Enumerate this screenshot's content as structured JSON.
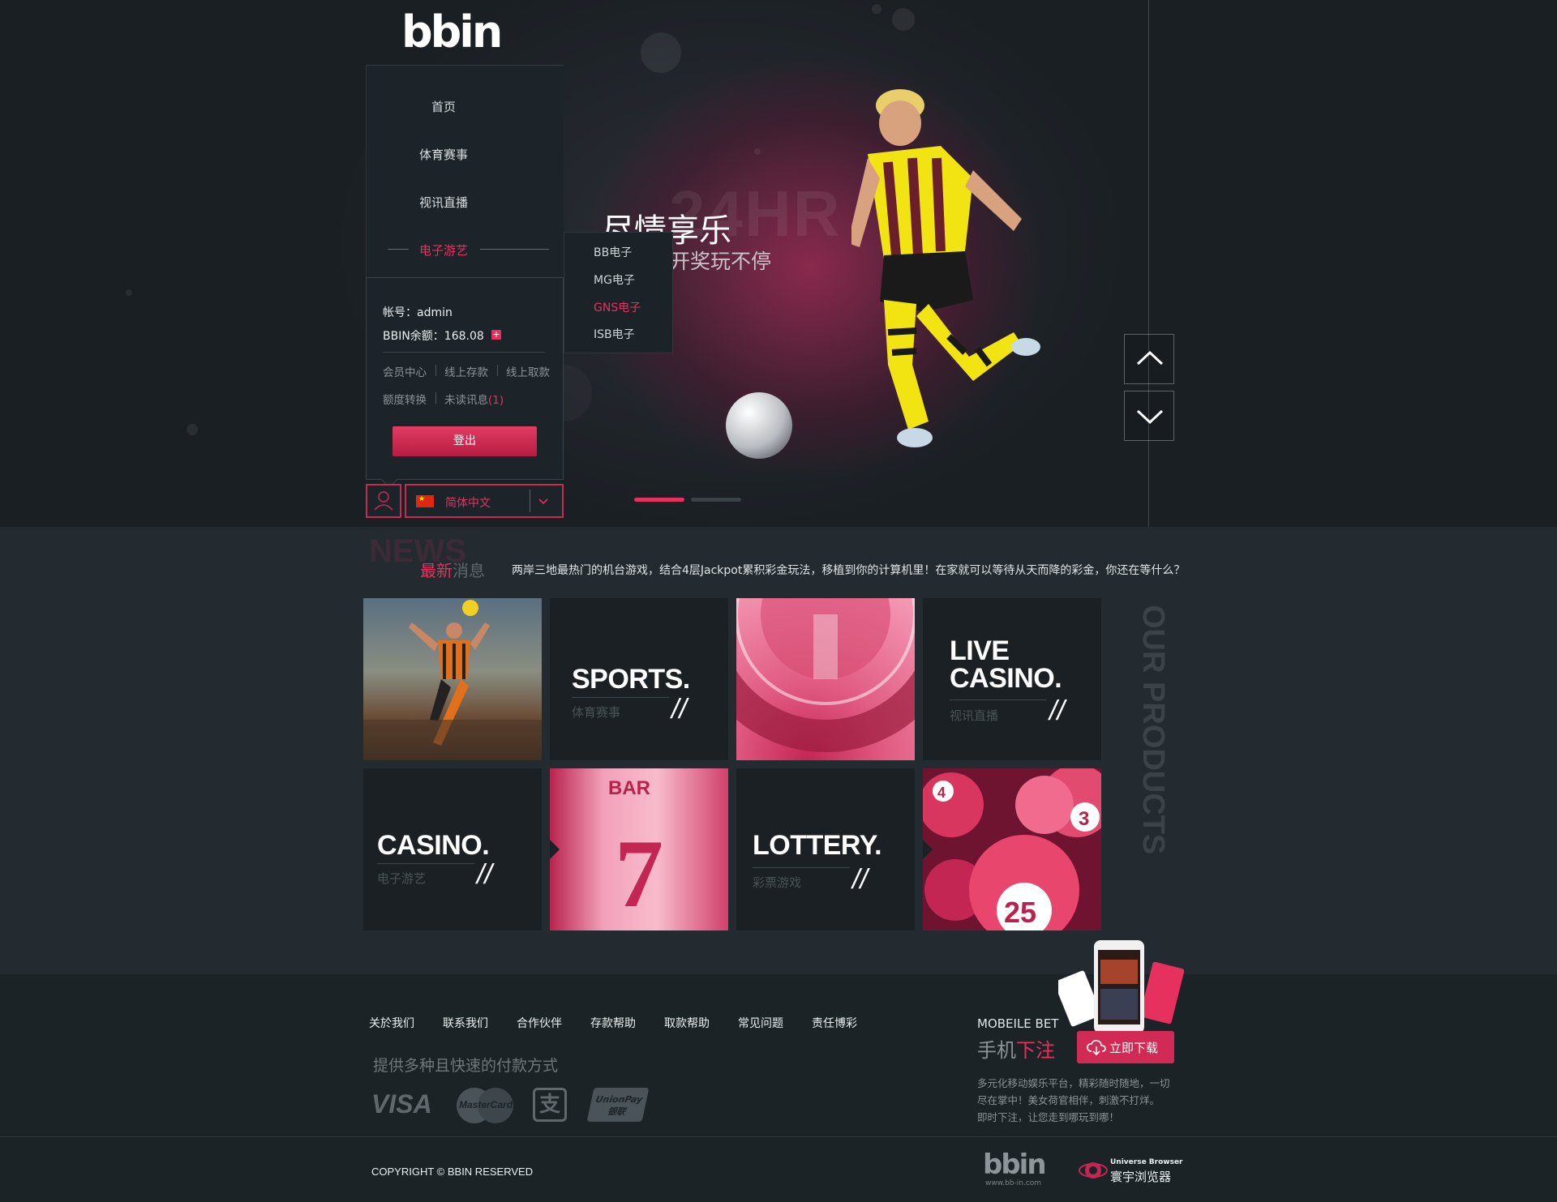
{
  "brand": {
    "logo_text": "bbin",
    "footer_logo_url": "www.bb-in.com"
  },
  "nav": {
    "items": [
      {
        "label": "首页"
      },
      {
        "label": "体育赛事"
      },
      {
        "label": "视讯直播"
      },
      {
        "label": "电子游艺",
        "active": true
      }
    ],
    "submenu": [
      {
        "label": "BB电子"
      },
      {
        "label": "MG电子"
      },
      {
        "label": "GNS电子",
        "active": true
      },
      {
        "label": "ISB电子"
      }
    ]
  },
  "user_panel": {
    "account_label": "帐号：admin",
    "balance_label": "BBIN余额：168.08",
    "plus_icon": "plus-icon",
    "links_row1": [
      "会员中心",
      "线上存款",
      "线上取款"
    ],
    "links_row2": [
      "额度转换",
      "未读讯息"
    ],
    "unread_count": "(1)",
    "logout_label": "登出"
  },
  "language": {
    "selected": "简体中文",
    "icon": "china-flag-icon"
  },
  "banner": {
    "watermark": "24HR",
    "title": "尽情享乐",
    "subtitle": "开奖玩不停",
    "slides_total": 2,
    "slide_active": 1
  },
  "news": {
    "watermark": "NEWS",
    "title_highlight": "最新",
    "title_rest": "消息",
    "marquee": "两岸三地最热门的机台游戏，结合4层Jackpot累积彩金玩法，移植到你的计算机里！在家就可以等待从天而降的彩金，你还在等什么？"
  },
  "products": {
    "side_title": "OUR PRODUCTS",
    "tiles": [
      {
        "en": "SPORTS.",
        "cn": "体育赛事"
      },
      {
        "en_line1": "LIVE",
        "en_line2": "CASINO.",
        "cn": "视讯直播"
      },
      {
        "en": "CASINO.",
        "cn": "电子游艺"
      },
      {
        "en": "LOTTERY.",
        "cn": "彩票游戏"
      }
    ],
    "slash": "//",
    "reel_text": "BAR",
    "reel_digit": "7",
    "lottery_numbers": [
      "3",
      "25",
      "4"
    ]
  },
  "footer": {
    "links": [
      "关於我们",
      "联系我们",
      "合作伙伴",
      "存款帮助",
      "取款帮助",
      "常见问题",
      "责任博彩"
    ],
    "payment_title": "提供多种且快速的付款方式",
    "payment_logos": [
      "VISA",
      "MasterCard",
      "支",
      "UnionPay 银联"
    ],
    "mobile_en": "MOBEILE BET",
    "mobile_cn_a": "手机",
    "mobile_cn_b": "下注",
    "download_label": "立即下载",
    "mobile_desc": [
      "多元化移动娱乐平台，精彩随时随地，一切",
      "尽在掌中！美女荷官相伴，刺激不打烊。",
      "即时下注，让您走到哪玩到哪！"
    ],
    "copyright": "COPYRIGHT © BBIN RESERVED",
    "browser_en": "Universe Browser",
    "browser_cn": "寰宇浏览器"
  },
  "colors": {
    "accent": "#e6315f",
    "panel": "#1d2429",
    "background": "#1b2226"
  }
}
